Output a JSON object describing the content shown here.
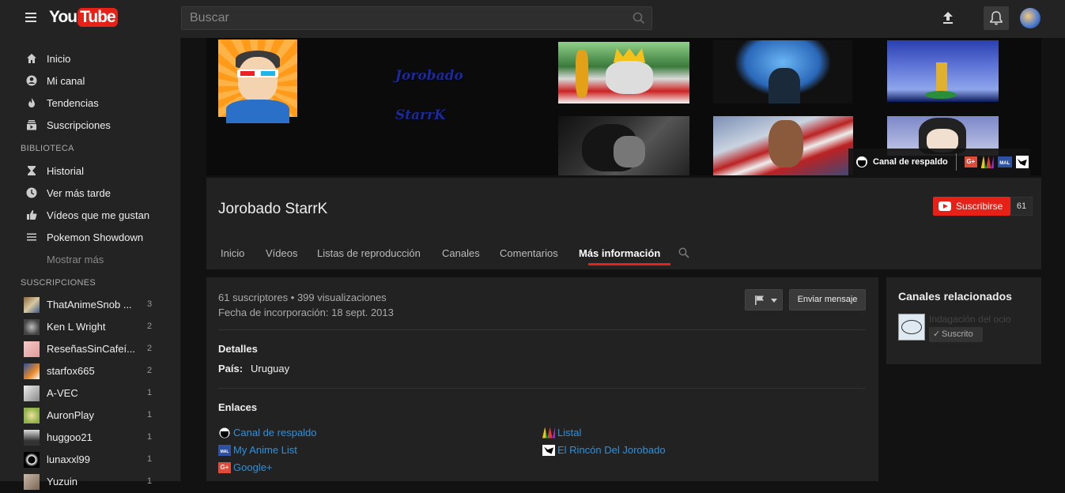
{
  "header": {
    "logo_you": "You",
    "logo_tube": "Tube",
    "search_placeholder": "Buscar"
  },
  "sidebar": {
    "main": [
      {
        "label": "Inicio",
        "icon": "home-icon"
      },
      {
        "label": "Mi canal",
        "icon": "account-icon"
      },
      {
        "label": "Tendencias",
        "icon": "flame-icon"
      },
      {
        "label": "Suscripciones",
        "icon": "subscriptions-icon"
      }
    ],
    "library_title": "BIBLIOTECA",
    "library": [
      {
        "label": "Historial",
        "icon": "hourglass-icon"
      },
      {
        "label": "Ver más tarde",
        "icon": "clock-icon"
      },
      {
        "label": "Vídeos que me gustan",
        "icon": "thumbs-up-icon"
      },
      {
        "label": "Pokemon Showdown",
        "icon": "playlist-icon"
      }
    ],
    "show_more": "Mostrar más",
    "subs_title": "SUSCRIPCIONES",
    "subscriptions": [
      {
        "name": "ThatAnimeSnob ...",
        "count": "3"
      },
      {
        "name": "Ken L Wright",
        "count": "2"
      },
      {
        "name": "ReseñasSinCafeí...",
        "count": "2"
      },
      {
        "name": "starfox665",
        "count": "2"
      },
      {
        "name": "A-VEC",
        "count": "1"
      },
      {
        "name": "AuronPlay",
        "count": "1"
      },
      {
        "name": "huggoo21",
        "count": "1"
      },
      {
        "name": "lunaxxl99",
        "count": "1"
      },
      {
        "name": "Yuzuin",
        "count": "1"
      }
    ]
  },
  "banner": {
    "title_line1": "Jorobado",
    "title_line2": "StarrK",
    "backup_label": "Canal de respaldo"
  },
  "channel": {
    "name": "Jorobado StarrK",
    "subscribe_label": "Suscribirse",
    "subscriber_count": "61",
    "tabs": [
      "Inicio",
      "Vídeos",
      "Listas de reproducción",
      "Canales",
      "Comentarios",
      "Más información"
    ],
    "active_tab": "Más información"
  },
  "about": {
    "stats_subs": "61 suscriptores",
    "stats_views": "399 visualizaciones",
    "joined": "Fecha de incorporación: 18 sept. 2013",
    "message_button": "Enviar mensaje",
    "details_title": "Detalles",
    "country_label": "País:",
    "country_value": "Uruguay",
    "links_title": "Enlaces",
    "links": [
      {
        "label": "Canal de respaldo",
        "icon": "backup-channel-icon"
      },
      {
        "label": "My Anime List",
        "icon": "mal-icon"
      },
      {
        "label": "Google+",
        "icon": "google-plus-icon"
      },
      {
        "label": "Listal",
        "icon": "listal-icon"
      },
      {
        "label": "El Rincón Del Jorobado",
        "icon": "blog-icon"
      }
    ]
  },
  "related": {
    "title": "Canales relacionados",
    "channel_name": "Indagación del ocio",
    "subscribed_label": "Suscrito"
  },
  "colors": {
    "accent": "#e62117",
    "link": "#2793e6",
    "background": "#121212",
    "panel": "#222222"
  }
}
